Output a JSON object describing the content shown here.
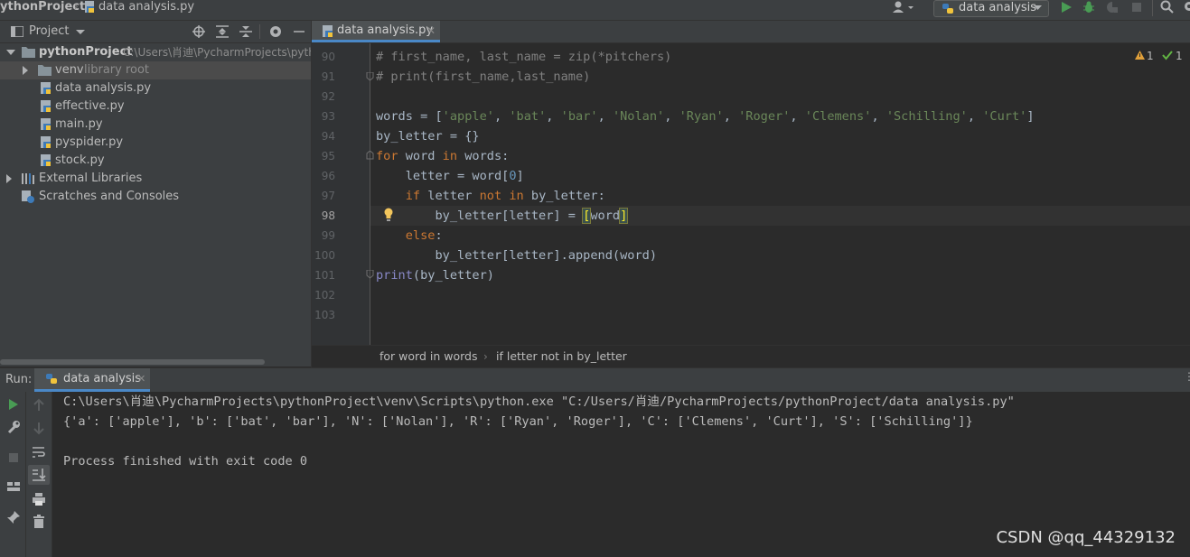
{
  "navbar": {
    "project_crumb": "ythonProject",
    "file_crumb": "data analysis.py",
    "run_config": "data analysis"
  },
  "project_panel": {
    "title": "Project",
    "items": [
      {
        "label": "pythonProject",
        "hint": "C:\\Users\\肖迪\\PycharmProjects\\pyth",
        "icon": "folder-icon"
      },
      {
        "label": "venv",
        "hint": "library root",
        "icon": "folder-icon"
      },
      {
        "label": "data analysis.py",
        "icon": "python-file-icon"
      },
      {
        "label": "effective.py",
        "icon": "python-file-icon"
      },
      {
        "label": "main.py",
        "icon": "python-file-icon"
      },
      {
        "label": "pyspider.py",
        "icon": "python-file-icon"
      },
      {
        "label": "stock.py",
        "icon": "python-file-icon"
      },
      {
        "label": "External Libraries",
        "icon": "library-icon"
      },
      {
        "label": "Scratches and Consoles",
        "icon": "scratch-icon"
      }
    ]
  },
  "editor": {
    "tab_label": "data analysis.py",
    "line_numbers": [
      "90",
      "91",
      "92",
      "93",
      "94",
      "95",
      "96",
      "97",
      "98",
      "99",
      "100",
      "101",
      "102",
      "103"
    ],
    "current_line": "98",
    "inspection": {
      "warnings": "1",
      "checks": "1"
    },
    "lines": [
      "# first_name, last_name = zip(*pitchers)",
      "# print(first_name,last_name)",
      "",
      "words = ['apple', 'bat', 'bar', 'Nolan', 'Ryan', 'Roger', 'Clemens', 'Schilling', 'Curt']",
      "by_letter = {}",
      "for word in words:",
      "    letter = word[0]",
      "    if letter not in by_letter:",
      "        by_letter[letter] = [word]",
      "    else:",
      "        by_letter[letter].append(word)",
      "print(by_letter)",
      "",
      ""
    ],
    "breadcrumb": [
      "for word in words",
      "if letter not in by_letter"
    ]
  },
  "run_panel": {
    "label": "Run:",
    "tab_label": "data analysis",
    "console_lines": [
      "C:\\Users\\肖迪\\PycharmProjects\\pythonProject\\venv\\Scripts\\python.exe \"C:/Users/肖迪/PycharmProjects/pythonProject/data analysis.py\"",
      "{'a': ['apple'], 'b': ['bat', 'bar'], 'N': ['Nolan'], 'R': ['Ryan', 'Roger'], 'C': ['Clemens', 'Curt'], 'S': ['Schilling']}",
      "",
      "Process finished with exit code 0"
    ]
  },
  "watermark": "CSDN @qq_44329132",
  "colors": {
    "background": "#2b2b2b",
    "panel": "#3c3f41",
    "keyword": "#cc7832",
    "string": "#6a8759",
    "comment": "#808080",
    "run_green": "#499c54",
    "accent": "#4a88c7"
  }
}
